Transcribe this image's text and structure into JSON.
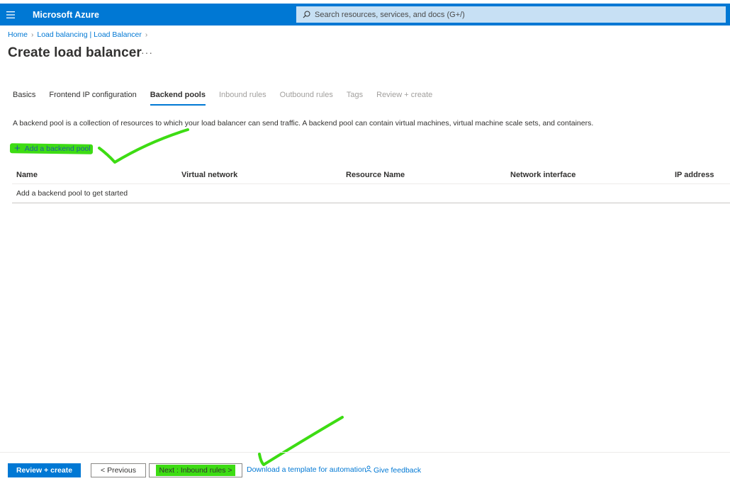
{
  "topbar": {
    "menu_icon": "hamburger-icon",
    "brand": "Microsoft Azure",
    "search_placeholder": "Search resources, services, and docs (G+/)",
    "search_icon": "search-icon",
    "color": "#0078d4"
  },
  "breadcrumb": [
    {
      "label": "Home"
    },
    {
      "label": "Load balancing | Load Balancer"
    }
  ],
  "page": {
    "title": "Create load balancer",
    "more_label": "···"
  },
  "tabs": [
    {
      "label": "Basics",
      "state": "normal"
    },
    {
      "label": "Frontend IP configuration",
      "state": "normal"
    },
    {
      "label": "Backend pools",
      "state": "active"
    },
    {
      "label": "Inbound rules",
      "state": "disabled"
    },
    {
      "label": "Outbound rules",
      "state": "disabled"
    },
    {
      "label": "Tags",
      "state": "disabled"
    },
    {
      "label": "Review + create",
      "state": "disabled"
    }
  ],
  "description": "A backend pool is a collection of resources to which your load balancer can send traffic. A backend pool can contain virtual machines, virtual machine scale sets, and containers.",
  "add_pool": {
    "label": "Add a backend pool",
    "icon": "plus-icon"
  },
  "table": {
    "columns": [
      "Name",
      "Virtual network",
      "Resource Name",
      "Network interface",
      "IP address"
    ],
    "empty_message": "Add a backend pool to get started"
  },
  "footer": {
    "review_create": "Review + create",
    "previous": "< Previous",
    "next": "Next : Inbound rules >",
    "download_template": "Download a template for automation",
    "feedback": "Give feedback",
    "feedback_icon": "feedback-person-icon"
  },
  "annotation_color": "#3ddc13"
}
